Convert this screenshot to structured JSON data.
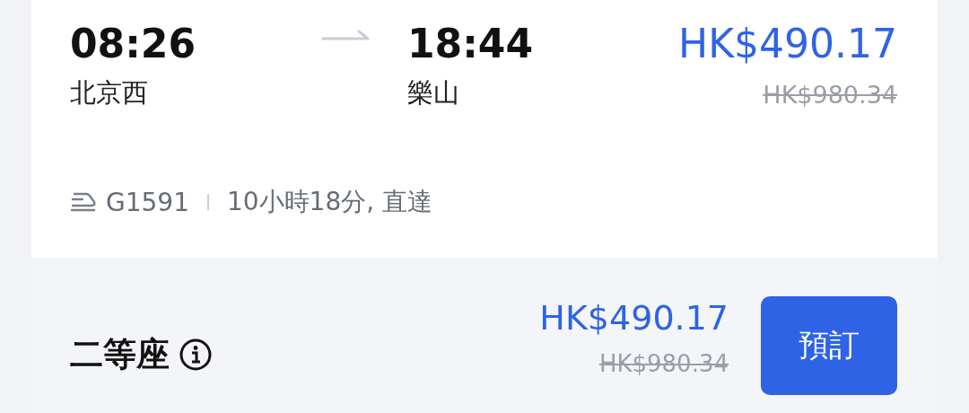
{
  "journey": {
    "departure": {
      "time": "08:26",
      "station": "北京西"
    },
    "arrival": {
      "time": "18:44",
      "station": "樂山"
    },
    "price": "HK$490.17",
    "original_price": "HK$980.34",
    "train_number": "G1591",
    "duration": "10小時18分, 直達"
  },
  "seat_options": [
    {
      "name": "二等座",
      "price": "HK$490.17",
      "original_price": "HK$980.34",
      "button": "預訂"
    }
  ]
}
